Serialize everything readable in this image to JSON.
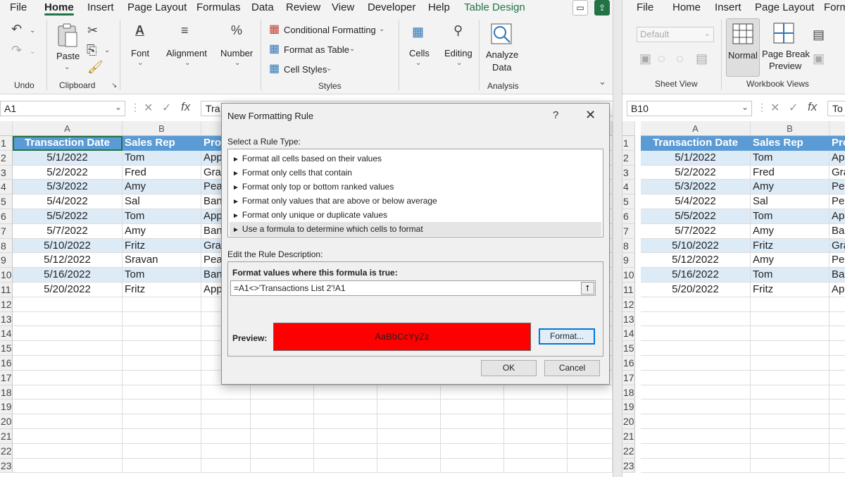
{
  "left": {
    "menu": [
      "File",
      "Home",
      "Insert",
      "Page Layout",
      "Formulas",
      "Data",
      "Review",
      "View",
      "Developer",
      "Help",
      "Table Design"
    ],
    "ribbon": {
      "undo_group": "Undo",
      "paste": "Paste",
      "clipboard_group": "Clipboard",
      "font": "Font",
      "alignment": "Alignment",
      "number": "Number",
      "conditional_formatting": "Conditional Formatting",
      "format_as_table": "Format as Table",
      "cell_styles": "Cell Styles",
      "styles_group": "Styles",
      "cells": "Cells",
      "editing": "Editing",
      "analyze_data_line1": "Analyze",
      "analyze_data_line2": "Data",
      "analysis_group": "Analysis"
    },
    "name_box": "A1",
    "formula_text": "Tra",
    "columns": [
      "A",
      "B"
    ],
    "headers": [
      "Transaction Date",
      "Sales Rep",
      "Pro"
    ],
    "rows": [
      [
        "5/1/2022",
        "Tom",
        "App"
      ],
      [
        "5/2/2022",
        "Fred",
        "Grap"
      ],
      [
        "5/3/2022",
        "Amy",
        "Pea"
      ],
      [
        "5/4/2022",
        "Sal",
        "Ban"
      ],
      [
        "5/5/2022",
        "Tom",
        "App"
      ],
      [
        "5/7/2022",
        "Amy",
        "Ban"
      ],
      [
        "5/10/2022",
        "Fritz",
        "Grap"
      ],
      [
        "5/12/2022",
        "Sravan",
        "Pea"
      ],
      [
        "5/16/2022",
        "Tom",
        "Ban"
      ],
      [
        "5/20/2022",
        "Fritz",
        "App"
      ]
    ],
    "row_numbers": [
      "1",
      "2",
      "3",
      "4",
      "5",
      "6",
      "7",
      "8",
      "9",
      "10",
      "11",
      "12",
      "13",
      "14",
      "15",
      "16",
      "17",
      "18",
      "19",
      "20",
      "21",
      "22",
      "23"
    ]
  },
  "right": {
    "menu": [
      "File",
      "Home",
      "Insert",
      "Page Layout",
      "Form"
    ],
    "ribbon": {
      "style_dropdown": "Default",
      "normal": "Normal",
      "page_break_line1": "Page Break",
      "page_break_line2": "Preview",
      "sheet_view_group": "Sheet View",
      "workbook_views_group": "Workbook Views"
    },
    "name_box": "B10",
    "formula_text": "To",
    "columns": [
      "A",
      "B"
    ],
    "headers": [
      "Transaction Date",
      "Sales Rep",
      "Pro"
    ],
    "rows": [
      [
        "5/1/2022",
        "Tom",
        "App"
      ],
      [
        "5/2/2022",
        "Fred",
        "Gra"
      ],
      [
        "5/3/2022",
        "Amy",
        "Pea"
      ],
      [
        "5/4/2022",
        "Sal",
        "Pea"
      ],
      [
        "5/5/2022",
        "Tom",
        "App"
      ],
      [
        "5/7/2022",
        "Amy",
        "Bar"
      ],
      [
        "5/10/2022",
        "Fritz",
        "Gra"
      ],
      [
        "5/12/2022",
        "Amy",
        "Pea"
      ],
      [
        "5/16/2022",
        "Tom",
        "Bar"
      ],
      [
        "5/20/2022",
        "Fritz",
        "App"
      ]
    ],
    "row_numbers": [
      "1",
      "2",
      "3",
      "4",
      "5",
      "6",
      "7",
      "8",
      "9",
      "10",
      "11",
      "12",
      "13",
      "14",
      "15",
      "16",
      "17",
      "18",
      "19",
      "20",
      "21",
      "22",
      "23"
    ]
  },
  "dialog": {
    "title": "New Formatting Rule",
    "help": "?",
    "close": "✕",
    "select_rule_type_label": "Select a Rule Type:",
    "rule_types": [
      "Format all cells based on their values",
      "Format only cells that contain",
      "Format only top or bottom ranked values",
      "Format only values that are above or below average",
      "Format only unique or duplicate values",
      "Use a formula to determine which cells to format"
    ],
    "selected_rule_index": 5,
    "edit_rule_label": "Edit the Rule Description:",
    "formula_label": "Format values where this formula is true:",
    "formula_value": "=A1<>'Transactions List 2'!A1",
    "preview_label": "Preview:",
    "preview_text": "AaBbCcYyZz",
    "preview_fill": "#ff0000",
    "format_button": "Format...",
    "ok_button": "OK",
    "cancel_button": "Cancel"
  },
  "colors": {
    "header_blue": "#5b9bd5",
    "band_blue": "#ddebf7",
    "excel_green": "#217346"
  }
}
